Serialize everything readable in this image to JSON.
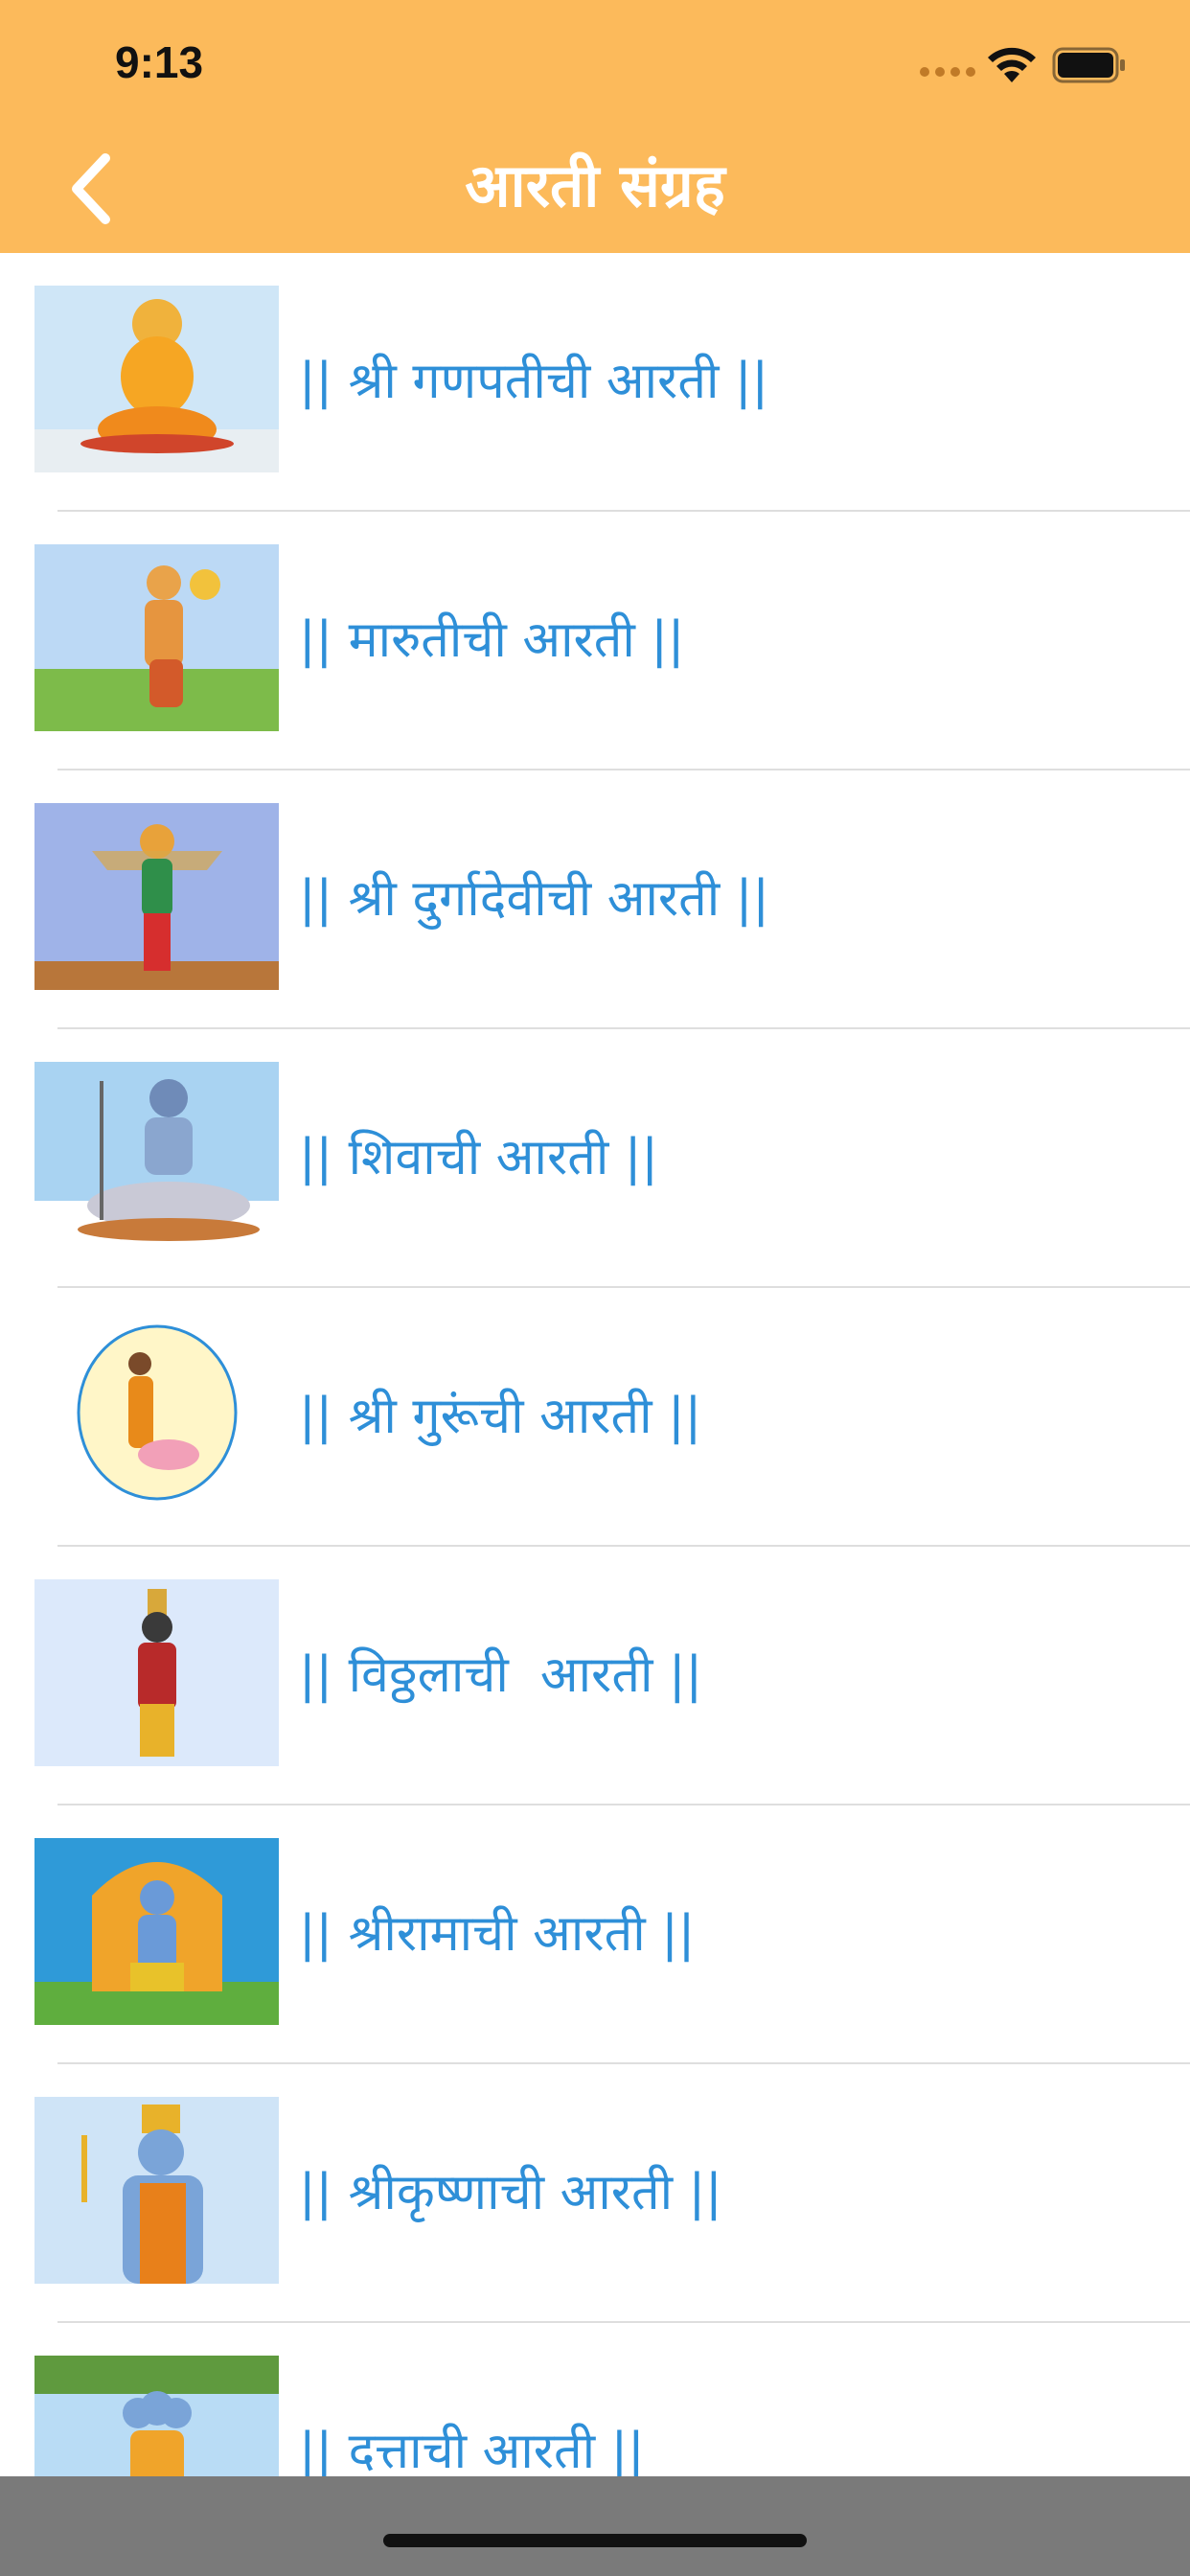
{
  "status_bar": {
    "time": "9:13",
    "signal": "signal-dots-icon",
    "wifi": "wifi-icon",
    "battery": "battery-icon"
  },
  "header": {
    "title": "आरती संग्रह",
    "back_icon": "chevron-left-icon",
    "background_color": "#FCBA5B"
  },
  "aarti_list": [
    {
      "label": "|| श्री गणपतीची आरती ||",
      "image": "ganpati-image"
    },
    {
      "label": "|| मारुतीची आरती ||",
      "image": "maruti-image"
    },
    {
      "label": "|| श्री दुर्गादेवीची आरती ||",
      "image": "durga-devi-image"
    },
    {
      "label": "|| शिवाची आरती ||",
      "image": "shiva-image"
    },
    {
      "label": "|| श्री गुरूंची आरती ||",
      "image": "guru-image"
    },
    {
      "label": "|| विठ्ठलाची  आरती ||",
      "image": "vitthal-image"
    },
    {
      "label": "|| श्रीरामाची आरती ||",
      "image": "shri-ram-image"
    },
    {
      "label": "|| श्रीकृष्णाची आरती ||",
      "image": "shri-krishna-image"
    },
    {
      "label": "|| दत्ताची आरती ||",
      "image": "datta-image"
    }
  ],
  "colors": {
    "label_text": "#2E8FD8",
    "separator": "#dedede"
  }
}
